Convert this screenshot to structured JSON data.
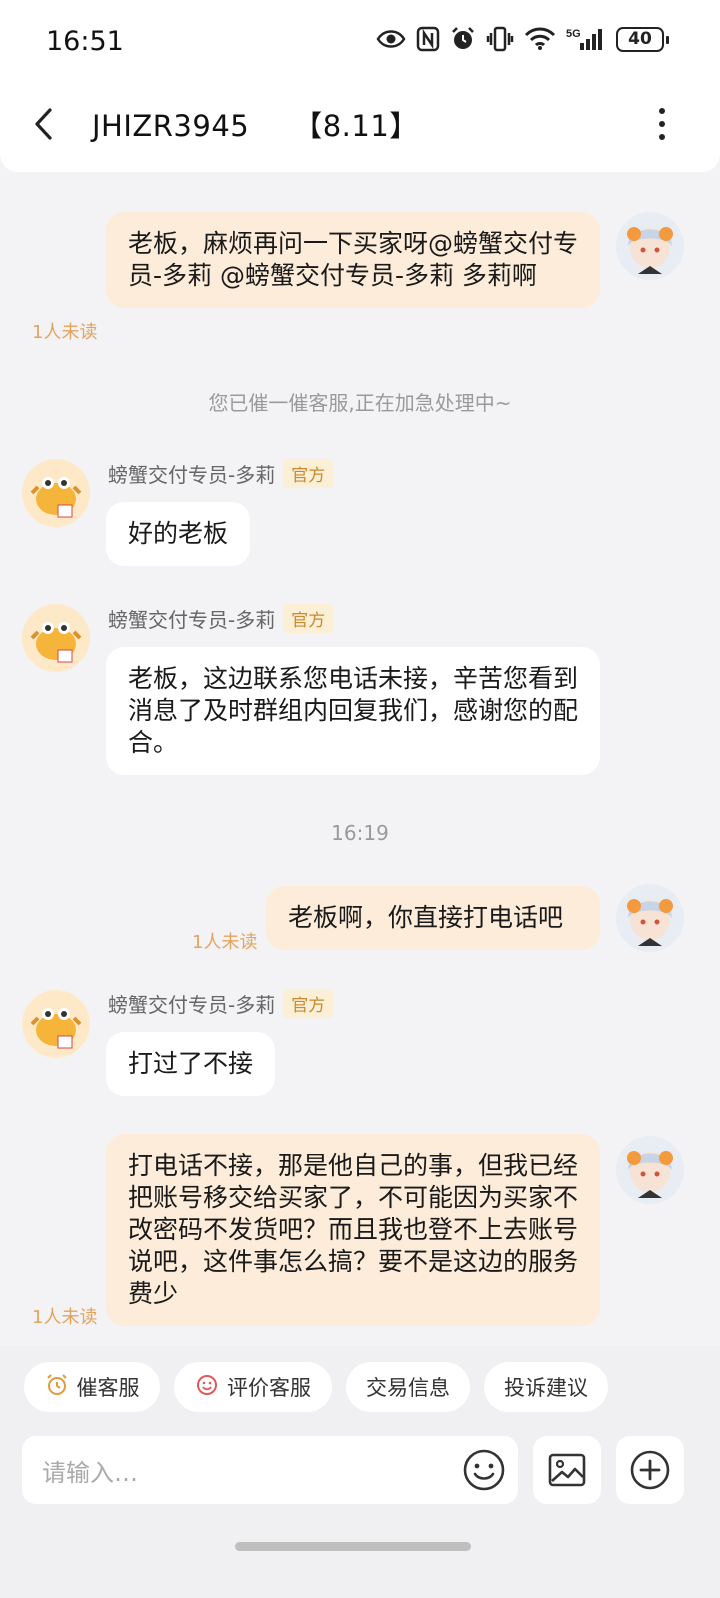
{
  "status_bar": {
    "time": "16:51",
    "network": "5G",
    "battery": "40"
  },
  "header": {
    "title": "JHIZR3945",
    "tag": "【8.11】"
  },
  "messages": [
    {
      "type": "mine",
      "text": "老板，麻烦再问一下买家呀@螃蟹交付专员-多莉 @螃蟹交付专员-多莉 多莉啊",
      "unread": "1人未读"
    },
    {
      "type": "system",
      "text": "您已催一催客服,正在加急处理中~"
    },
    {
      "type": "other",
      "sender": "螃蟹交付专员-多莉",
      "badge": "官方",
      "text": "好的老板"
    },
    {
      "type": "other",
      "sender": "螃蟹交付专员-多莉",
      "badge": "官方",
      "text": "老板，这边联系您电话未接，辛苦您看到消息了及时群组内回复我们，感谢您的配合。"
    },
    {
      "type": "time",
      "text": "16:19"
    },
    {
      "type": "mine",
      "text": "老板啊，你直接打电话吧",
      "unread": "1人未读"
    },
    {
      "type": "other",
      "sender": "螃蟹交付专员-多莉",
      "badge": "官方",
      "text": "打过了不接"
    },
    {
      "type": "mine",
      "text": "打电话不接，那是他自己的事，但我已经把账号移交给买家了，不可能因为买家不改密码不发货吧？而且我也登不上去账号说吧，这件事怎么搞？要不是这边的服务费少",
      "unread": "1人未读"
    }
  ],
  "quick_actions": [
    "催客服",
    "评价客服",
    "交易信息",
    "投诉建议"
  ],
  "composer": {
    "placeholder": "请输入…"
  },
  "colors": {
    "mine_bubble": "#fcecd9",
    "other_bubble": "#ffffff",
    "unread": "#e3a35c",
    "official_badge": "#fbefd5"
  }
}
